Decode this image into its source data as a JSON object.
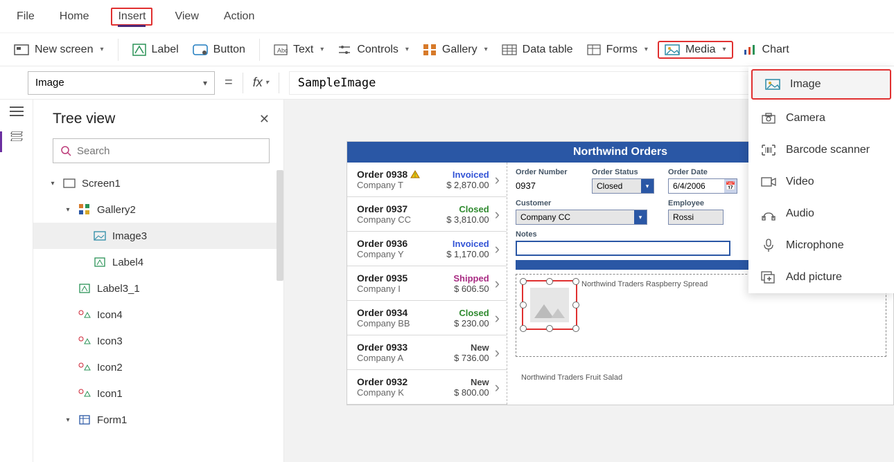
{
  "menu": {
    "file": "File",
    "home": "Home",
    "insert": "Insert",
    "view": "View",
    "action": "Action"
  },
  "ribbon": {
    "new_screen": "New screen",
    "label": "Label",
    "button": "Button",
    "text": "Text",
    "controls": "Controls",
    "gallery": "Gallery",
    "data_table": "Data table",
    "forms": "Forms",
    "media": "Media",
    "chart": "Chart"
  },
  "formula": {
    "property": "Image",
    "value": "SampleImage"
  },
  "tree": {
    "title": "Tree view",
    "search_placeholder": "Search",
    "items": {
      "screen1": "Screen1",
      "gallery2": "Gallery2",
      "image3": "Image3",
      "label4": "Label4",
      "label3_1": "Label3_1",
      "icon4": "Icon4",
      "icon3": "Icon3",
      "icon2": "Icon2",
      "icon1": "Icon1",
      "form1": "Form1"
    }
  },
  "app": {
    "title": "Northwind Orders",
    "orders": [
      {
        "num": "Order 0938",
        "company": "Company T",
        "status": "Invoiced",
        "status_class": "invoiced",
        "price": "$ 2,870.00",
        "warn": true
      },
      {
        "num": "Order 0937",
        "company": "Company CC",
        "status": "Closed",
        "status_class": "closed",
        "price": "$ 3,810.00"
      },
      {
        "num": "Order 0936",
        "company": "Company Y",
        "status": "Invoiced",
        "status_class": "invoiced",
        "price": "$ 1,170.00"
      },
      {
        "num": "Order 0935",
        "company": "Company I",
        "status": "Shipped",
        "status_class": "shipped",
        "price": "$ 606.50"
      },
      {
        "num": "Order 0934",
        "company": "Company BB",
        "status": "Closed",
        "status_class": "closed",
        "price": "$ 230.00"
      },
      {
        "num": "Order 0933",
        "company": "Company A",
        "status": "New",
        "status_class": "new",
        "price": "$ 736.00"
      },
      {
        "num": "Order 0932",
        "company": "Company K",
        "status": "New",
        "status_class": "new",
        "price": "$ 800.00"
      }
    ],
    "form": {
      "order_number_label": "Order Number",
      "order_number": "0937",
      "order_status_label": "Order Status",
      "order_status": "Closed",
      "order_date_label": "Order Date",
      "order_date": "6/4/2006",
      "customer_label": "Customer",
      "customer": "Company CC",
      "employee_label": "Employee",
      "employee": "Rossi",
      "notes_label": "Notes",
      "item_caption": "Northwind Traders Raspberry Spread",
      "fruit_salad": "Northwind Traders Fruit Salad"
    }
  },
  "media_menu": {
    "image": "Image",
    "camera": "Camera",
    "barcode": "Barcode scanner",
    "video": "Video",
    "audio": "Audio",
    "microphone": "Microphone",
    "add_picture": "Add picture"
  }
}
